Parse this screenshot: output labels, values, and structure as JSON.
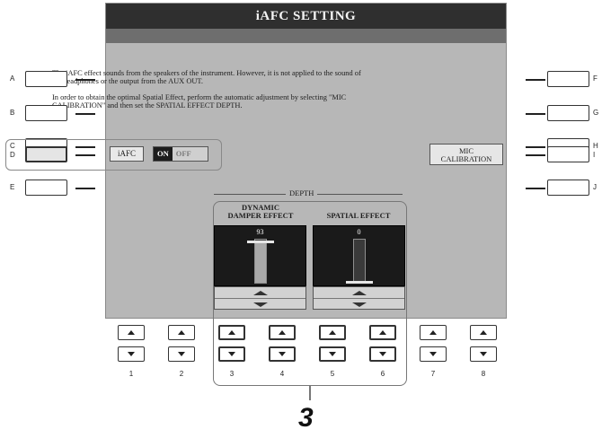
{
  "screen": {
    "title": "iAFC SETTING",
    "info_paragraph_1": "The iAFC effect sounds from the speakers of the instrument. However, it is not applied to the sound of the headphones or the output from the AUX OUT.",
    "info_paragraph_2": "In order to obtain the optimal Spatial Effect, perform the automatic adjustment by selecting \"MIC CALIBRATION\" and then set the SPATIAL EFFECT DEPTH.",
    "iafc_label": "iAFC",
    "toggle": {
      "on_label": "ON",
      "off_label": "OFF",
      "selected": "ON"
    },
    "mic_calibration_line1": "MIC",
    "mic_calibration_line2": "CALIBRATION",
    "depth_label": "DEPTH",
    "effects": [
      {
        "title_line1": "DYNAMIC",
        "title_line2": "DAMPER EFFECT",
        "value": "93",
        "level": 0.93
      },
      {
        "title_line1": "",
        "title_line2": "SPATIAL EFFECT",
        "value": "0",
        "level": 0.0
      }
    ]
  },
  "side_buttons": {
    "left": [
      "A",
      "B",
      "C",
      "D",
      "E"
    ],
    "right": [
      "F",
      "G",
      "H",
      "I",
      "J"
    ],
    "highlighted": "D"
  },
  "bottom_buttons": [
    "1",
    "2",
    "3",
    "4",
    "5",
    "6",
    "7",
    "8"
  ],
  "step_number": "3",
  "colors": {
    "screen_bg": "#b7b7b7",
    "title_bar": "#2f2f2f",
    "panel_bg": "#1a1a1a"
  }
}
